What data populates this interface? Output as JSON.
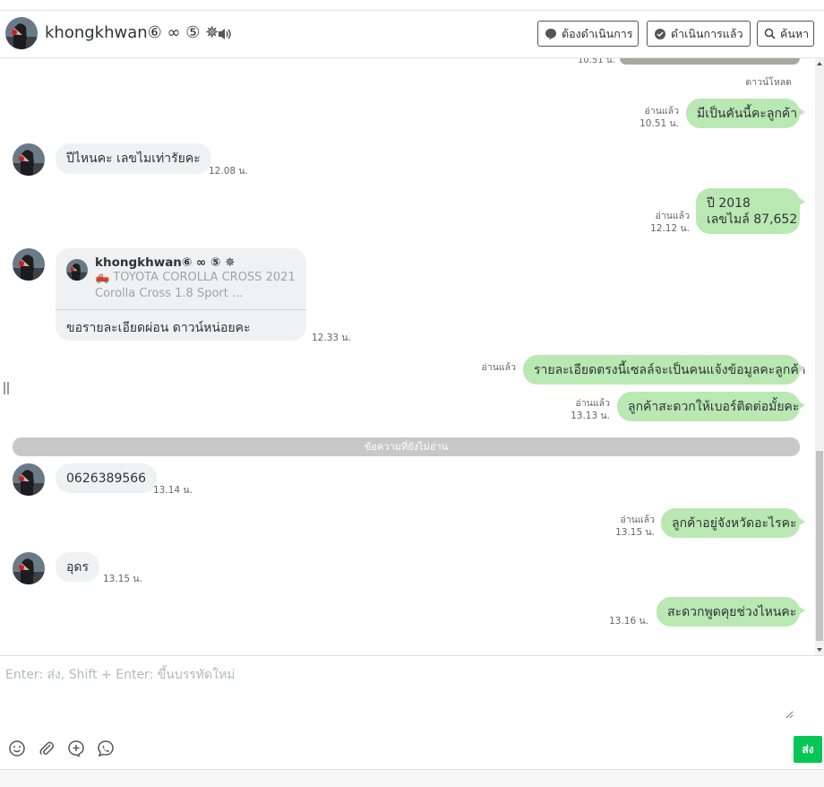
{
  "colors": {
    "outgoing_bubble": "#b9e8b2",
    "incoming_bubble": "#f0f1f3",
    "send_button": "#06c755",
    "unread_bar": "#c8c8c8"
  },
  "header": {
    "contact_name": "khongkhwan⑥ ∞ ⑤ ✵",
    "speaker_icon": "speaker-icon",
    "buttons": [
      {
        "label": "ต้องดำเนินการ",
        "icon": "speech-bubble-icon"
      },
      {
        "label": "ดำเนินการแล้ว",
        "icon": "check-bubble-icon"
      },
      {
        "label": "ค้นหา",
        "icon": "search-icon"
      }
    ]
  },
  "chat": {
    "top_partial_time": "10.51 น.",
    "download_label": "ดาวน์โหลด",
    "messages": [
      {
        "dir": "out",
        "text": "มีเป็นคันนี้คะลูกค้า",
        "read": "อ่านแล้ว",
        "time": "10.51 น."
      },
      {
        "dir": "in",
        "text": "ปีไหนคะ เลขไมเท่ารัยคะ",
        "time": "12.08 น."
      },
      {
        "dir": "out",
        "lines": [
          "ปี 2018",
          "เลขไมล์ 87,652"
        ],
        "read": "อ่านแล้ว",
        "time": "12.12 น."
      },
      {
        "dir": "in",
        "type": "reply",
        "quote": {
          "name": "khongkhwan⑥ ∞ ⑤ ✵",
          "line1": "🛻 TOYOTA COROLLA CROSS 2021",
          "line2": "Corolla Cross 1.8 Sport ..."
        },
        "text": "ขอรายละเอียดผ่อน ดาวน์หน่อยคะ",
        "time": "12.33 น."
      },
      {
        "dir": "out",
        "text": "รายละเอียดตรงนี้เซลล์จะเป็นคนแจ้งข้อมูลคะลูกค้า",
        "read": "อ่านแล้ว"
      },
      {
        "dir": "out",
        "text": "ลูกค้าสะดวกให้เบอร์ติดต่อมั้ยคะ",
        "read": "อ่านแล้ว",
        "time": "13.13 น."
      },
      {
        "dir": "in",
        "text": "0626389566",
        "time": "13.14 น."
      },
      {
        "dir": "out",
        "text": "ลูกค้าอยู่จังหวัดอะไรคะ",
        "read": "อ่านแล้ว",
        "time": "13.15 น."
      },
      {
        "dir": "in",
        "text": "อุดร",
        "time": "13.15 น."
      },
      {
        "dir": "out",
        "text": "สะดวกพูดคุยช่วงไหนคะ",
        "time": "13.16 น."
      }
    ],
    "unread_divider": "ข้อความที่ยังไม่อ่าน"
  },
  "composer": {
    "placeholder": "Enter: ส่ง, Shift + Enter: ขึ้นบรรทัดใหม่",
    "tools": [
      "emoji-icon",
      "paperclip-icon",
      "plus-icon",
      "voice-call-icon"
    ],
    "send_label": "ส่ง"
  }
}
